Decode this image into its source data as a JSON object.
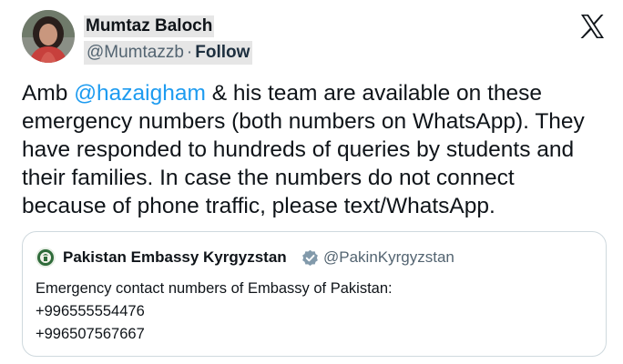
{
  "author": {
    "display_name": "Mumtaz Baloch",
    "handle": "@Mumtazzb",
    "separator": "·",
    "follow_label": "Follow"
  },
  "tweet": {
    "text_before": "Amb ",
    "mention": "@hazaigham",
    "text_after": " & his team are available on these emergency numbers (both numbers on WhatsApp). They have responded to hundreds of queries by students and their families. In case the numbers do not connect because of phone traffic, please text/WhatsApp."
  },
  "quoted_tweet": {
    "display_name": "Pakistan Embassy Kyrgyzstan",
    "handle": "@PakinKyrgyzstan",
    "lines": [
      "Emergency contact numbers of Embassy of Pakistan:",
      "+996555554476",
      "+996507567667"
    ]
  },
  "icons": {
    "brand": "x-logo-icon",
    "verified": "verified-badge-icon"
  },
  "colors": {
    "mention": "#1d9bf0",
    "verified_badge": "#829aab",
    "border": "#cfd9de",
    "secondary_text": "#536471"
  }
}
